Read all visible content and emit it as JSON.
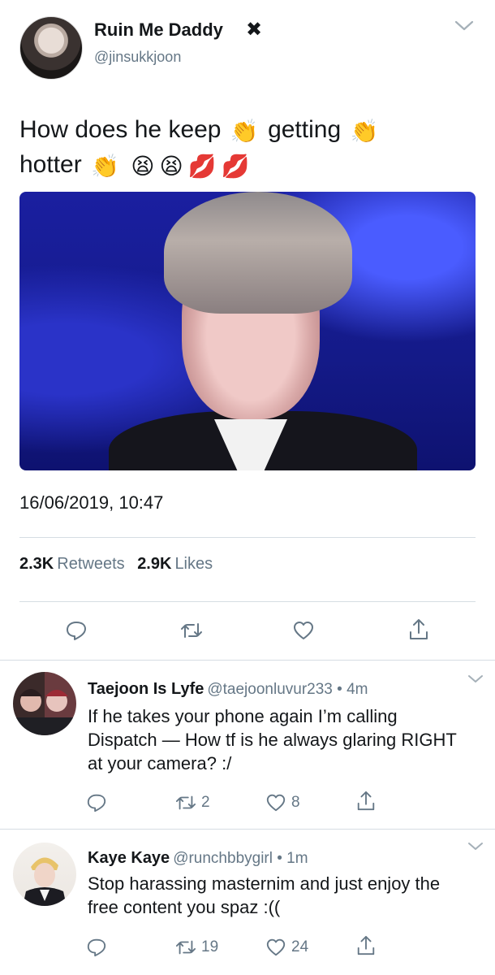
{
  "tweet": {
    "display_name": "Ruin Me Daddy",
    "handle": "@jinsukkjoon",
    "text_segments": [
      "How does he keep",
      "getting",
      "hotter"
    ],
    "emojis": {
      "clap": "👏",
      "weary": "😫",
      "kiss": "💋"
    },
    "timestamp": "16/06/2019, 10:47",
    "retweets_count": "2.3K",
    "retweets_label": "Retweets",
    "likes_count": "2.9K",
    "likes_label": "Likes"
  },
  "replies": [
    {
      "name": "Taejoon Is Lyfe",
      "handle": "@taejoonluvur233 • 4m",
      "text": "If he takes your phone again I’m calling Dispatch — How tf is he always glaring RIGHT at your camera? :/",
      "retweets": "2",
      "likes": "8"
    },
    {
      "name": "Kaye Kaye",
      "handle": "@runchbbygirl • 1m",
      "text": "Stop harassing masternim and just enjoy the free content you spaz  :((",
      "retweets": "19",
      "likes": "24"
    }
  ],
  "colors": {
    "text": "#14171a",
    "secondary": "#657786",
    "icon": "#657786",
    "divider": "#d6dde3"
  },
  "icons": [
    "x-icon",
    "chevron-down-icon",
    "reply-icon",
    "retweet-icon",
    "like-icon",
    "share-icon"
  ]
}
